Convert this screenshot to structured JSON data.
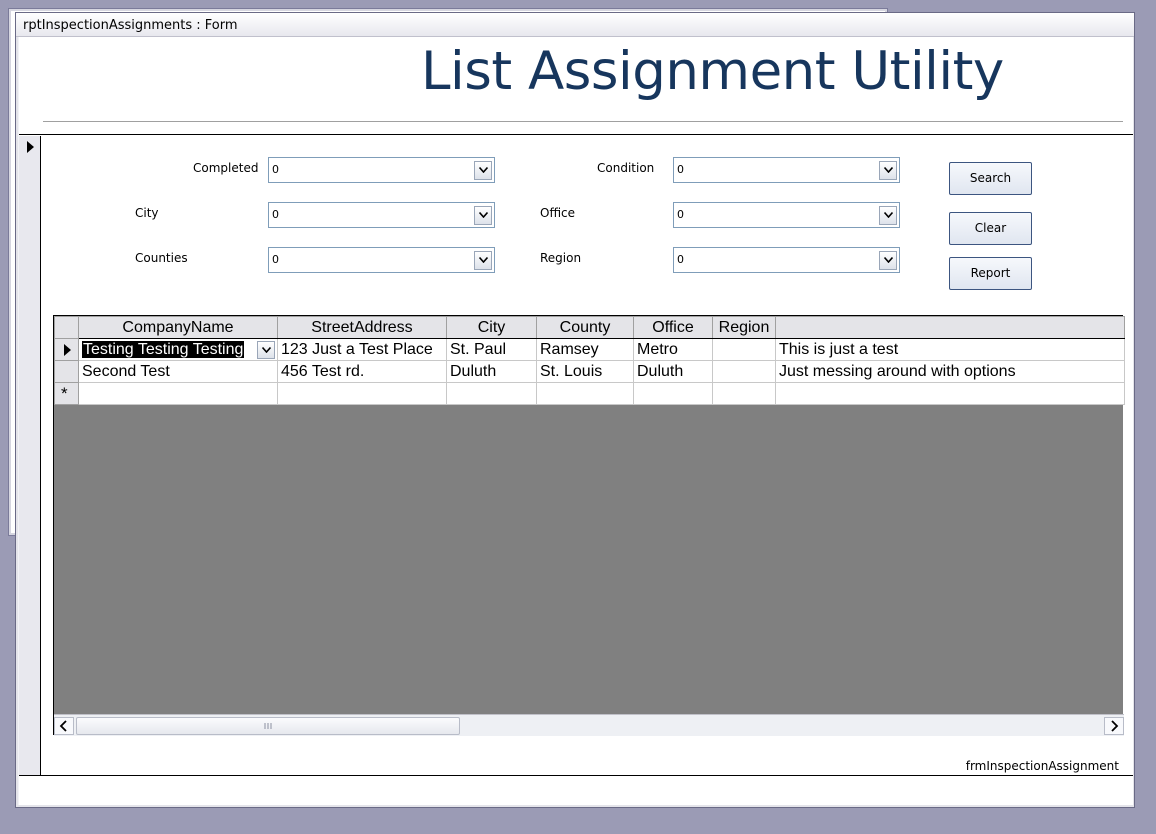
{
  "window": {
    "title": "rptInspectionAssignments : Form"
  },
  "header": {
    "title": "List Assignment Utility"
  },
  "filters": {
    "completed": {
      "label": "Completed",
      "value": "0"
    },
    "city": {
      "label": "City",
      "value": "0"
    },
    "counties": {
      "label": "Counties",
      "value": "0"
    },
    "condition": {
      "label": "Condition",
      "value": "0"
    },
    "office": {
      "label": "Office",
      "value": "0"
    },
    "region": {
      "label": "Region",
      "value": "0"
    }
  },
  "buttons": {
    "search": "Search",
    "clear": "Clear",
    "report": "Report"
  },
  "grid": {
    "columns": [
      "CompanyName",
      "StreetAddress",
      "City",
      "County",
      "Office",
      "Region",
      ""
    ],
    "rows": [
      [
        "Testing Testing Testing",
        "123 Just a Test Place",
        "St. Paul",
        "Ramsey",
        "Metro",
        "",
        "This is just a test"
      ],
      [
        "Second Test",
        "456 Test rd.",
        "Duluth",
        "St. Louis",
        "Duluth",
        "",
        "Just messing around with options"
      ]
    ],
    "new_row_marker": "*"
  },
  "footer": {
    "form_name": "frmInspectionAssignment"
  },
  "icons": {
    "record_selector": "current-record-arrow-icon",
    "dropdown": "chevron-down-icon",
    "scroll_left": "chevron-left-icon",
    "scroll_right": "chevron-right-icon"
  },
  "colors": {
    "title": "#17365d",
    "grid_bg": "#808080",
    "background": "#9b9bb5"
  }
}
